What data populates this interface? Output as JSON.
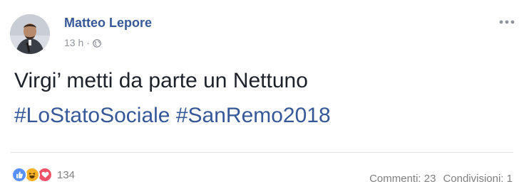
{
  "post": {
    "author": "Matteo Lepore",
    "time": "13 h",
    "separator": "·",
    "privacy_icon": "globe-icon",
    "more_icon": "ellipsis-icon",
    "text_line1": "Virgi’ metti da parte un Nettuno",
    "hashtag1": "#LoStatoSociale",
    "hashtag2": "#SanRemo2018"
  },
  "footer": {
    "reaction_icons": [
      "like-icon",
      "haha-icon",
      "love-icon"
    ],
    "reaction_count": "134",
    "comments": "Commenti: 23",
    "shares": "Condivisioni: 1"
  },
  "colors": {
    "link": "#365899",
    "text": "#1d2129",
    "muted": "#90949c",
    "like": "#5890ff",
    "haha": "#f7b125",
    "love": "#f25268"
  }
}
